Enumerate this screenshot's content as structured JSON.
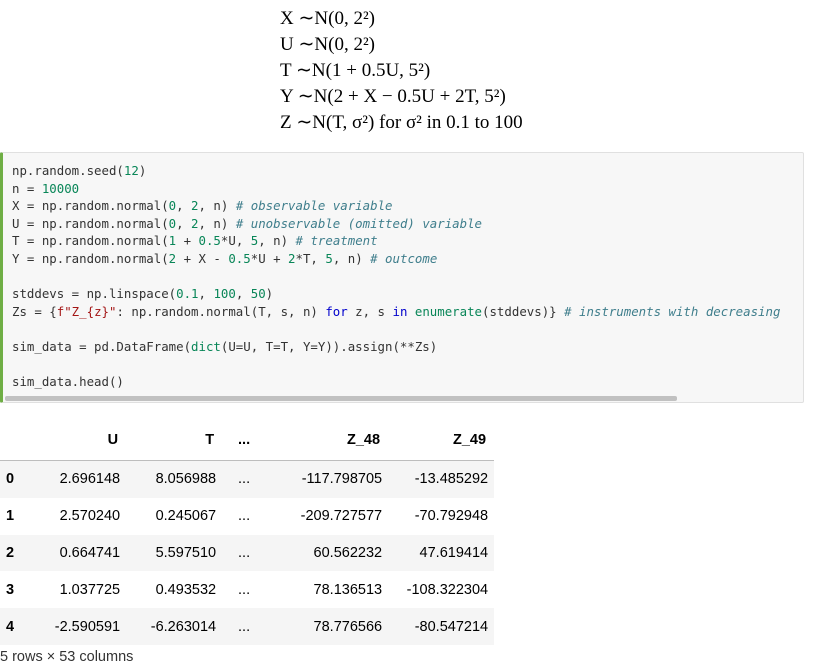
{
  "math": {
    "lines": [
      "X ∼N(0, 2²)",
      "U ∼N(0, 2²)",
      "T ∼N(1 + 0.5U, 5²)",
      "Y ∼N(2 + X − 0.5U + 2T, 5²)",
      "Z ∼N(T, σ²) for σ² in 0.1 to 100"
    ]
  },
  "code": {
    "l1": [
      "np.random.seed(",
      "12",
      ")"
    ],
    "l2": [
      "n = ",
      "10000"
    ],
    "l3": [
      "X = np.random.normal(",
      "0",
      ", ",
      "2",
      ", n) ",
      "# observable variable"
    ],
    "l4": [
      "U = np.random.normal(",
      "0",
      ", ",
      "2",
      ", n) ",
      "# unobservable (omitted) variable"
    ],
    "l5": [
      "T = np.random.normal(",
      "1",
      " + ",
      "0.5",
      "*U, ",
      "5",
      ", n) ",
      "# treatment"
    ],
    "l6": [
      "Y = np.random.normal(",
      "2",
      " + X - ",
      "0.5",
      "*U + ",
      "2",
      "*T, ",
      "5",
      ", n) ",
      "# outcome"
    ],
    "l8": [
      "stddevs = np.linspace(",
      "0.1",
      ", ",
      "100",
      ", ",
      "50",
      ")"
    ],
    "l9": [
      "Zs = {",
      "f\"Z_{z}\"",
      ": np.random.normal(T, s, n) ",
      "for",
      " z, s ",
      "in",
      " ",
      "enumerate",
      "(stddevs)} ",
      "# instruments with decreasing"
    ],
    "l11": [
      "sim_data = pd.DataFrame(",
      "dict",
      "(U=U, T=T, Y=Y)).assign(**Zs)"
    ],
    "l13": [
      "sim_data.head()"
    ]
  },
  "table": {
    "columns": [
      "U",
      "T",
      "...",
      "Z_48",
      "Z_49"
    ],
    "rows": [
      {
        "idx": "0",
        "cells": [
          "2.696148",
          "8.056988",
          "...",
          "-117.798705",
          "-13.485292"
        ]
      },
      {
        "idx": "1",
        "cells": [
          "2.570240",
          "0.245067",
          "...",
          "-209.727577",
          "-70.792948"
        ]
      },
      {
        "idx": "2",
        "cells": [
          "0.664741",
          "5.597510",
          "...",
          "60.562232",
          "47.619414"
        ]
      },
      {
        "idx": "3",
        "cells": [
          "1.037725",
          "0.493532",
          "...",
          "78.136513",
          "-108.322304"
        ]
      },
      {
        "idx": "4",
        "cells": [
          "-2.590591",
          "-6.263014",
          "...",
          "78.776566",
          "-80.547214"
        ]
      }
    ],
    "shape": "5 rows × 53 columns"
  }
}
